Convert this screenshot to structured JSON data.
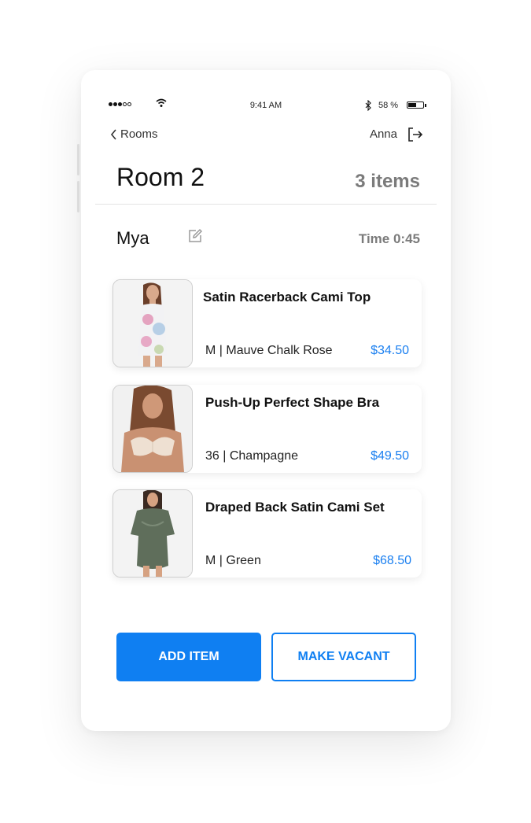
{
  "status_bar": {
    "time": "9:41 AM",
    "battery": "58 %",
    "battery_level": 0.58,
    "signal_bars": 3,
    "signal_total": 5
  },
  "nav": {
    "back_label": "Rooms",
    "user_name": "Anna"
  },
  "room": {
    "title": "Room 2",
    "items_count": "3 items"
  },
  "customer": {
    "name": "Mya",
    "timer": "Time 0:45"
  },
  "items": [
    {
      "name": "Satin Racerback Cami Top",
      "variant": "M | Mauve Chalk Rose",
      "price": "$34.50"
    },
    {
      "name": "Push-Up Perfect Shape Bra",
      "variant": "36 | Champagne",
      "price": "$49.50"
    },
    {
      "name": "Draped Back Satin Cami Set",
      "variant": "M | Green",
      "price": "$68.50"
    }
  ],
  "actions": {
    "add_item": "ADD ITEM",
    "make_vacant": "MAKE VACANT"
  },
  "colors": {
    "accent": "#0f7ff2",
    "muted": "#7b7b7b"
  }
}
